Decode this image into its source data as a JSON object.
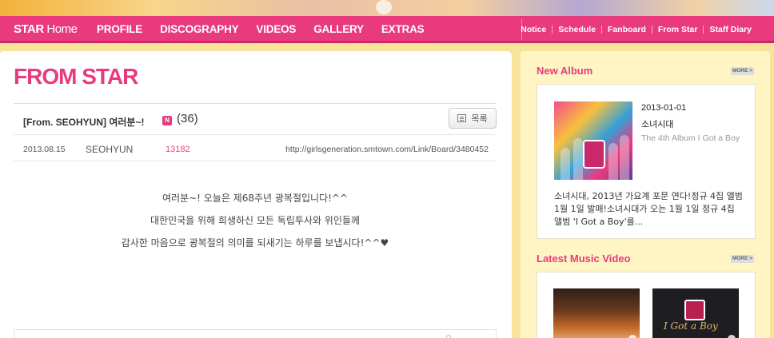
{
  "nav": {
    "brand_strong": "STAR",
    "brand_light": " Home",
    "main_items": [
      "PROFILE",
      "DISCOGRAPHY",
      "VIDEOS",
      "GALLERY",
      "EXTRAS"
    ],
    "sub_items": [
      "Notice",
      "Schedule",
      "Fanboard",
      "From Star",
      "Staff Diary"
    ]
  },
  "page": {
    "title": "FROM STAR"
  },
  "post": {
    "title": "[From. SEOHYUN] 여러분~!",
    "new_badge": "N",
    "comments": "(36)",
    "list_button": "목록",
    "date": "2013.08.15",
    "author": "SEOHYUN",
    "views": "13182",
    "url": "http://girlsgeneration.smtown.com/Link/Board/3480452",
    "body": [
      "여러분~!  오늘은 제68주년 광복절입니다!^^",
      "대한민국을 위해 희생하신 모든 독립투사와 위인들께",
      "감사한 마음으로 광복절의 의미를 되새기는 하루를 보냅시다!^^♥"
    ]
  },
  "sidebar": {
    "new_album": {
      "header": "New Album",
      "more": "MORE >",
      "date": "2013-01-01",
      "artist": "소녀시대",
      "title": "The 4th Album I Got a Boy",
      "description": "소녀시대, 2013년 가요계 포문 연다!정규 4집 앨범 1월 1일 발매!소녀시대가 오는 1월 1일 정규 4집 앨범 'I Got a Boy'를..."
    },
    "latest_video": {
      "header": "Latest Music Video",
      "more": "MORE >",
      "thumb2_script": "I Got a Boy"
    }
  },
  "colors": {
    "accent": "#ea3a7e",
    "background": "#f7e39a",
    "sidebar_bg": "#fff4c4"
  }
}
